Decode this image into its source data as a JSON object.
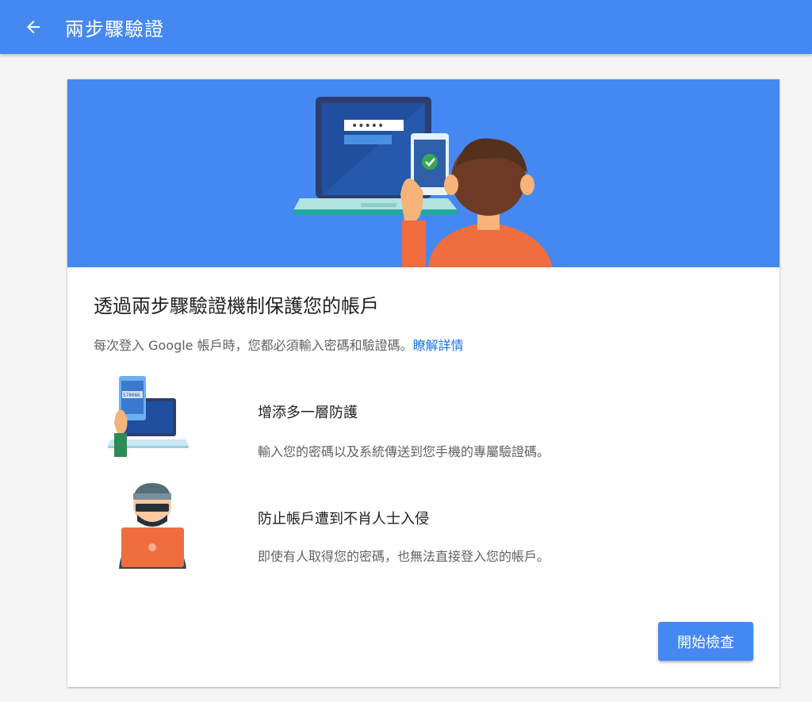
{
  "appbar": {
    "title": "兩步驟驗證",
    "back_icon": "arrow-left-icon"
  },
  "hero": {
    "password_mask": "•••••",
    "colors": {
      "background": "#4688f1",
      "laptop": "#1e3a8a",
      "shirt": "#f06d40",
      "hair": "#6d3b25",
      "check": "#34a853"
    }
  },
  "main": {
    "headline": "透過兩步驟驗證機制保護您的帳戶",
    "subtext": "每次登入 Google 帳戶時，您都必須輸入密碼和驗證碼。",
    "learn_more": "瞭解詳情"
  },
  "features": [
    {
      "title": "增添多一層防護",
      "description": "輸入您的密碼以及系統傳送到您手機的專屬驗證碼。",
      "illustration": "phone-laptop-icon",
      "code": "578066"
    },
    {
      "title": "防止帳戶遭到不肖人士入侵",
      "description": "即使有人取得您的密碼，也無法直接登入您的帳戶。",
      "illustration": "hacker-icon"
    }
  ],
  "actions": {
    "start_label": "開始檢查"
  }
}
